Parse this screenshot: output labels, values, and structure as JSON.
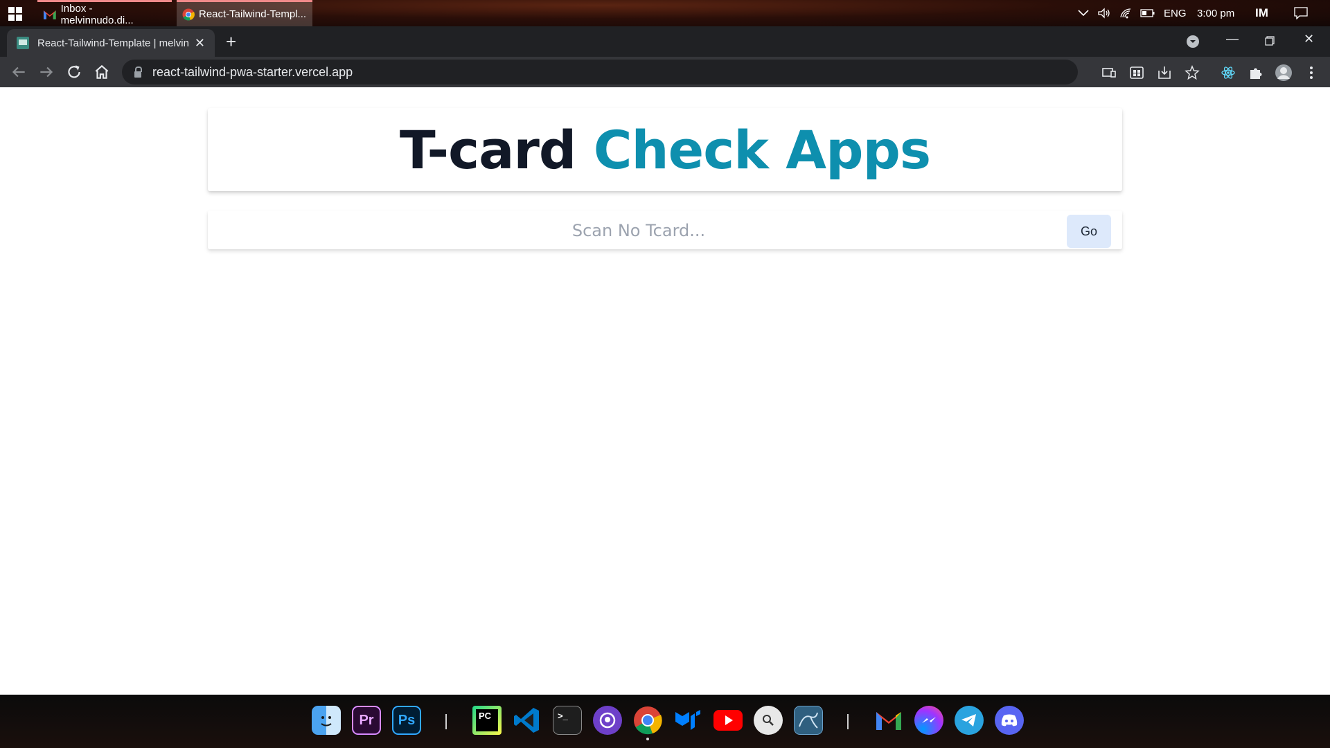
{
  "os_taskbar": {
    "tasks": [
      {
        "label": "Inbox - melvinnudo.di..."
      },
      {
        "label": "React-Tailwind-Templ..."
      }
    ],
    "tray": {
      "language": "ENG",
      "time": "3:00 pm",
      "app_label": "IM"
    }
  },
  "browser": {
    "tab_title": "React-Tailwind-Template | melvin",
    "url": "react-tailwind-pwa-starter.vercel.app"
  },
  "page": {
    "title_part1": "T-card",
    "title_part2": "Check Apps",
    "search_placeholder": "Scan No Tcard...",
    "search_value": "",
    "go_label": "Go"
  },
  "colors": {
    "title_dark": "#111827",
    "title_accent": "#0e8fae",
    "go_button_bg": "#dde9fb"
  },
  "dock": {
    "apps": [
      {
        "name": "finder",
        "glyph": ""
      },
      {
        "name": "premiere-pro",
        "glyph": "Pr"
      },
      {
        "name": "photoshop",
        "glyph": "Ps"
      },
      {
        "name": "pycharm",
        "glyph": "PC"
      },
      {
        "name": "vscode",
        "glyph": ""
      },
      {
        "name": "terminal",
        "glyph": ">_"
      },
      {
        "name": "github",
        "glyph": ""
      },
      {
        "name": "chrome",
        "glyph": ""
      },
      {
        "name": "mui",
        "glyph": ""
      },
      {
        "name": "youtube",
        "glyph": ""
      },
      {
        "name": "search",
        "glyph": ""
      },
      {
        "name": "mysql-workbench",
        "glyph": ""
      },
      {
        "name": "gmail",
        "glyph": "M"
      },
      {
        "name": "messenger",
        "glyph": ""
      },
      {
        "name": "telegram",
        "glyph": ""
      },
      {
        "name": "discord",
        "glyph": ""
      }
    ]
  }
}
